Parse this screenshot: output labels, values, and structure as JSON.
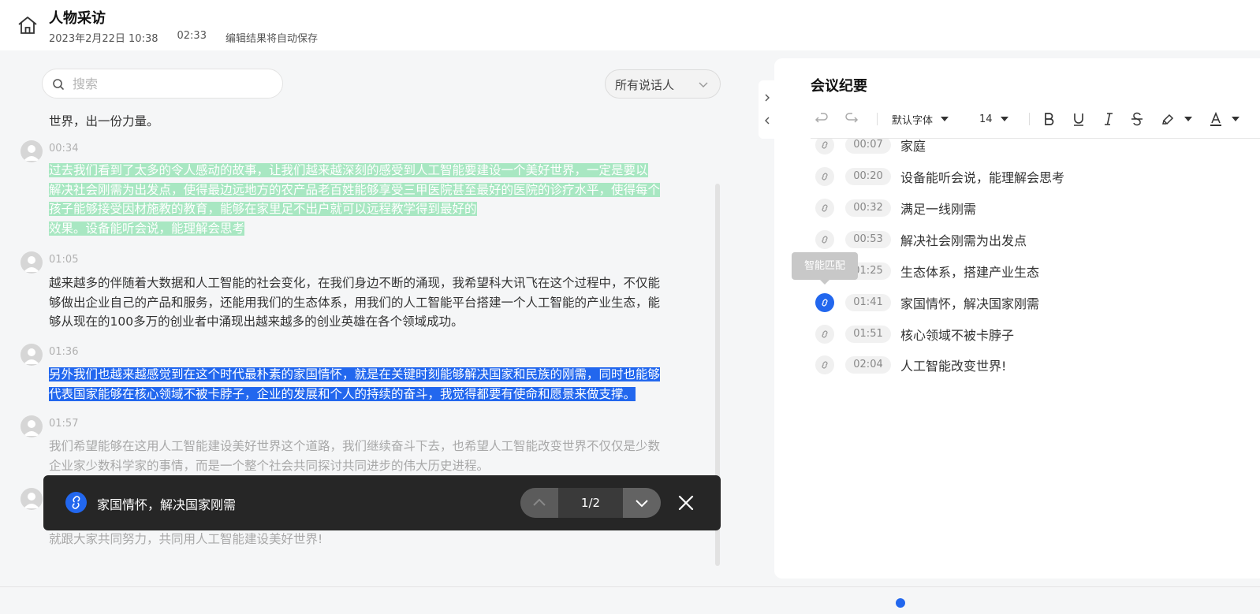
{
  "header": {
    "title": "人物采访",
    "datetime": "2023年2月22日 10:38",
    "duration": "02:33",
    "autosave": "编辑结果将自动保存"
  },
  "search": {
    "placeholder": "搜索",
    "value": ""
  },
  "speaker_filter": {
    "selected": "所有说话人"
  },
  "transcript": {
    "segments": [
      {
        "time": "",
        "text": "世界，出一份力量。"
      },
      {
        "time": "00:34",
        "lines": [
          "过去我们看到了太多的令人感动的故事，让我们越来越深刻的感受到人工智能要建设一个美好世界，一定是要以",
          "解决社会刚需为出发点，使得最边远地方的农产品老百姓能够享受三甲医院甚至最好的医院的诊疗水平，使得每个",
          "孩子能够接受因材施教的教育，能够在家里足不出户就可以远程教学得到最好的",
          "效果。设备能听会说，能理解会思考"
        ]
      },
      {
        "time": "01:05",
        "lines": [
          "越来越多的伴随着大数据和人工智能的社会变化，在我们身边不断的涌现，我希望科大讯飞在这个过程中，不仅能",
          "够做出企业自己的产品和服务，还能用我们的生态体系，用我们的人工智能平台搭建一个人工智能的产业生态，能",
          "够从现在的100多万的创业者中涌现出越来越多的创业英雄在各个领域成功。"
        ]
      },
      {
        "time": "01:36",
        "lines": [
          "另外我们也越来越感觉到在这个时代最朴素的家国情怀，就是在关键时刻能够解决国家和民族的刚需，同时也能够",
          "代表国家能够在核心领域不被卡脖子，企业的发展和个人的持续的奋斗，我觉得都要有使命和愿景来做支撑。"
        ]
      },
      {
        "time": "01:57",
        "lines": [
          "我们希望能够在这用人工智能建设美好世界这个道路，我们继续奋斗下去，也希望人工智能改变世界不仅仅是少数",
          "企业家少数科学家的事情，而是一个整个社会共同探讨共同进步的伟大历史进程。"
        ]
      },
      {
        "time": "",
        "lines": [
          "就跟大家共同努力，共同用人工智能建设美好世界!"
        ]
      }
    ]
  },
  "match_bar": {
    "text": "家国情怀，解决国家刚需",
    "counter": "1/2"
  },
  "minutes": {
    "title": "会议纪要",
    "toolbar": {
      "font_family": "默认字体",
      "font_size": "14"
    },
    "tooltip": "智能匹配",
    "key_points": [
      {
        "time": "00:07",
        "label": "家庭"
      },
      {
        "time": "00:20",
        "label": "设备能听会说，能理解会思考"
      },
      {
        "time": "00:32",
        "label": "满足一线刚需"
      },
      {
        "time": "00:53",
        "label": "解决社会刚需为出发点"
      },
      {
        "time": "01:25",
        "label": "生态体系，搭建产业生态"
      },
      {
        "time": "01:41",
        "label": "家国情怀，解决国家刚需"
      },
      {
        "time": "01:51",
        "label": "核心领域不被卡脖子"
      },
      {
        "time": "02:04",
        "label": "人工智能改变世界!"
      }
    ]
  },
  "colors": {
    "accent": "#2267ee",
    "highlight_green": "#a8e7c2",
    "dark_bar": "#262626"
  }
}
